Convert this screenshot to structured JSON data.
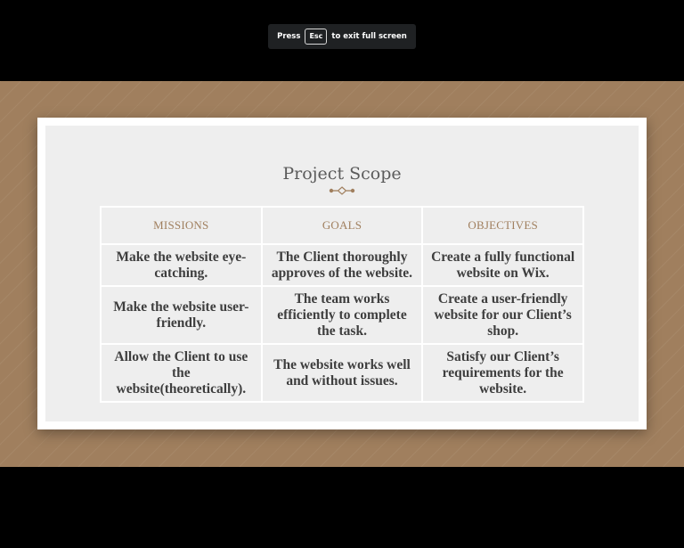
{
  "fullscreen_banner": {
    "press": "Press",
    "key": "Esc",
    "suffix": "to exit full screen"
  },
  "slide": {
    "title": "Project Scope",
    "colors": {
      "accent": "#a07f5e",
      "title": "#5b5b5b",
      "panel": "#eeeeee",
      "cell_text": "#3e3e3e"
    },
    "table": {
      "headers": [
        "MISSIONS",
        "GOALS",
        "OBJECTIVES"
      ],
      "rows": [
        [
          "Make the website eye-catching.",
          "The Client thoroughly approves of the website.",
          "Create a fully functional website on Wix."
        ],
        [
          "Make the website user-friendly.",
          "The team works efficiently to complete the task.",
          "Create a user-friendly website for our Client’s shop."
        ],
        [
          "Allow the Client to use the website(theoretically).",
          "The website works well and without issues.",
          "Satisfy our Client’s requirements for the website."
        ]
      ]
    }
  }
}
